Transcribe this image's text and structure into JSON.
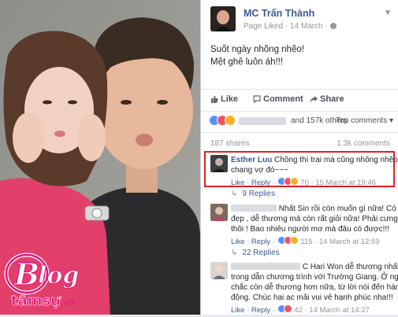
{
  "post": {
    "page_name": "MC Trấn Thành",
    "meta": "Page Liked · 14 March ·",
    "text_line1": "Suốt ngày nhõng nhẽo!",
    "text_line2": "Mệt ghê luôn áh!!!",
    "like_label": "Like",
    "comment_label": "Comment",
    "share_label": "Share",
    "reactions_others": "and 157k others",
    "top_comments": "Top comments ▾",
    "shares": "187 shares",
    "comments_count": "1.3k comments"
  },
  "comments": [
    {
      "name": "Esther Luu",
      "line1": "Chồng thì trai mà cũng nhõng nhẽo y",
      "line2": "chang vợ đó~~~",
      "like": "Like",
      "reply": "Reply",
      "count": "70",
      "time": "15 March at 19:46",
      "replies": "9 Replies"
    },
    {
      "name": "",
      "line1": "Nhất Sin rồi còn muốn gì nữa! Có vợ",
      "line2": "đẹp , dễ thương mà còn rất giỏi nữa! Phải cưng",
      "line3": "thôi ! Bao nhiêu người mơ mà đâu có được!!!",
      "like": "Like",
      "reply": "Reply",
      "count": "115",
      "time": "14 March at 12:59",
      "replies": "22 Replies"
    },
    {
      "name": "",
      "line1": "C Hari Won dễ thương nhất là",
      "line2": "trong dẫn chương trình với Trường Giang. Ở ngoài",
      "line3": "chắc còn dễ thương hơn nữa, từ lời nói đến hành",
      "line4": "động. Chúc hai ac mãi vui vẻ hạnh phúc nha!!!",
      "like": "Like",
      "reply": "Reply",
      "count": "42",
      "time": "14 March at 14:27"
    }
  ],
  "watermark": {
    "logo_text": "Blog",
    "sub_text": "tâmsự.vn"
  },
  "colors": {
    "fb_blue": "#3b5998",
    "highlight_red": "#e02020",
    "like_blue": "#5890ff",
    "love_red": "#f25268",
    "haha_yellow": "#f7b125",
    "logo_pink": "#e8137a"
  }
}
